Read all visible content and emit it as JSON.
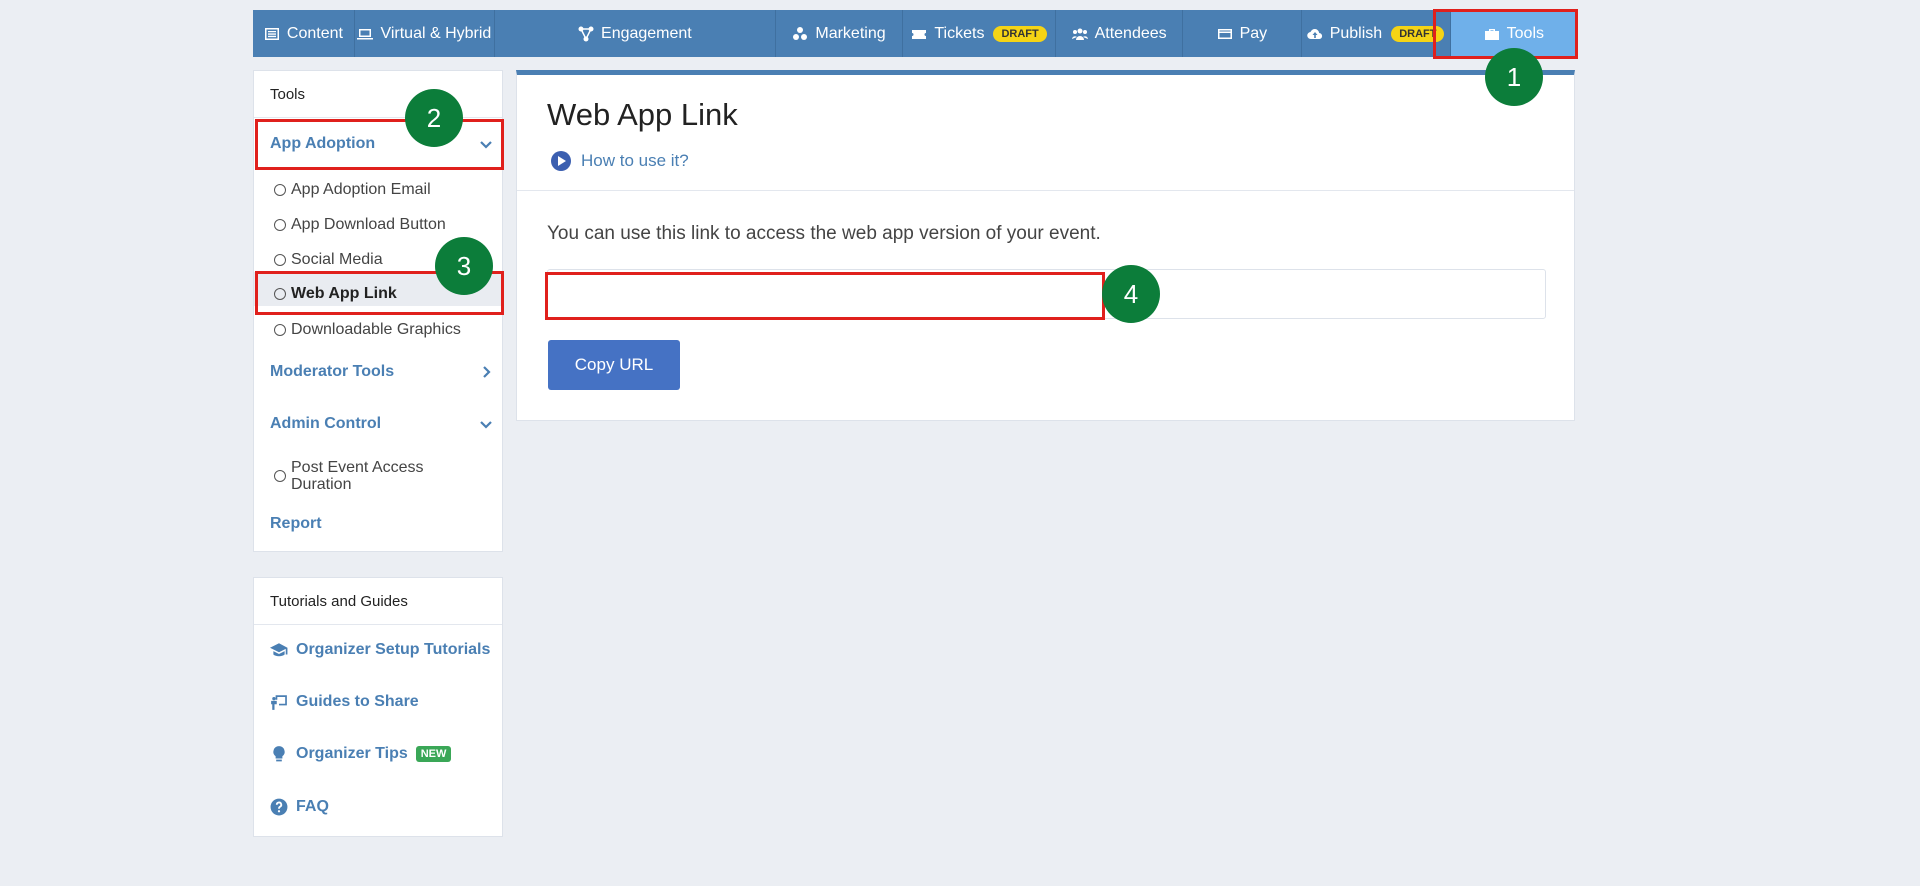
{
  "nav": {
    "items": [
      {
        "label": "Content",
        "icon": "list-icon"
      },
      {
        "label": "Virtual & Hybrid",
        "icon": "laptop-icon"
      },
      {
        "label": "Engagement",
        "icon": "network-icon"
      },
      {
        "label": "Marketing",
        "icon": "users-cluster-icon"
      },
      {
        "label": "Tickets",
        "icon": "ticket-icon",
        "badge": "DRAFT"
      },
      {
        "label": "Attendees",
        "icon": "people-icon"
      },
      {
        "label": "Pay",
        "icon": "card-icon"
      },
      {
        "label": "Publish",
        "icon": "cloud-upload-icon",
        "badge": "DRAFT"
      },
      {
        "label": "Tools",
        "icon": "briefcase-icon"
      }
    ]
  },
  "steps": [
    "1",
    "2",
    "3",
    "4"
  ],
  "sidebar": {
    "title": "Tools",
    "sections": [
      {
        "label": "App Adoption",
        "chevron": "down"
      },
      {
        "label": "Moderator Tools",
        "chevron": "right"
      },
      {
        "label": "Admin Control",
        "chevron": "down"
      },
      {
        "label": "Report"
      }
    ],
    "app_adoption_items": [
      "App Adoption Email",
      "App Download Button",
      "Social Media",
      "Web App Link",
      "Downloadable Graphics"
    ],
    "admin_items": [
      "Post Event Access Duration"
    ]
  },
  "tutorials": {
    "title": "Tutorials and Guides",
    "items": [
      {
        "label": "Organizer Setup Tutorials",
        "icon": "graduation-cap-icon"
      },
      {
        "label": "Guides to Share",
        "icon": "presentation-icon"
      },
      {
        "label": "Organizer Tips",
        "icon": "lightbulb-icon",
        "badge": "NEW"
      },
      {
        "label": "FAQ",
        "icon": "question-circle-icon"
      }
    ]
  },
  "main": {
    "title": "Web App Link",
    "how_to": "How to use it?",
    "description": "You can use this link to access the web app version of your event.",
    "url_value": "",
    "copy_label": "Copy URL"
  },
  "colors": {
    "nav": "#4a7fb3",
    "nav_active": "#6fb0ea",
    "highlight": "#e0201c",
    "step": "#0c7d3a",
    "button": "#4572c4"
  }
}
